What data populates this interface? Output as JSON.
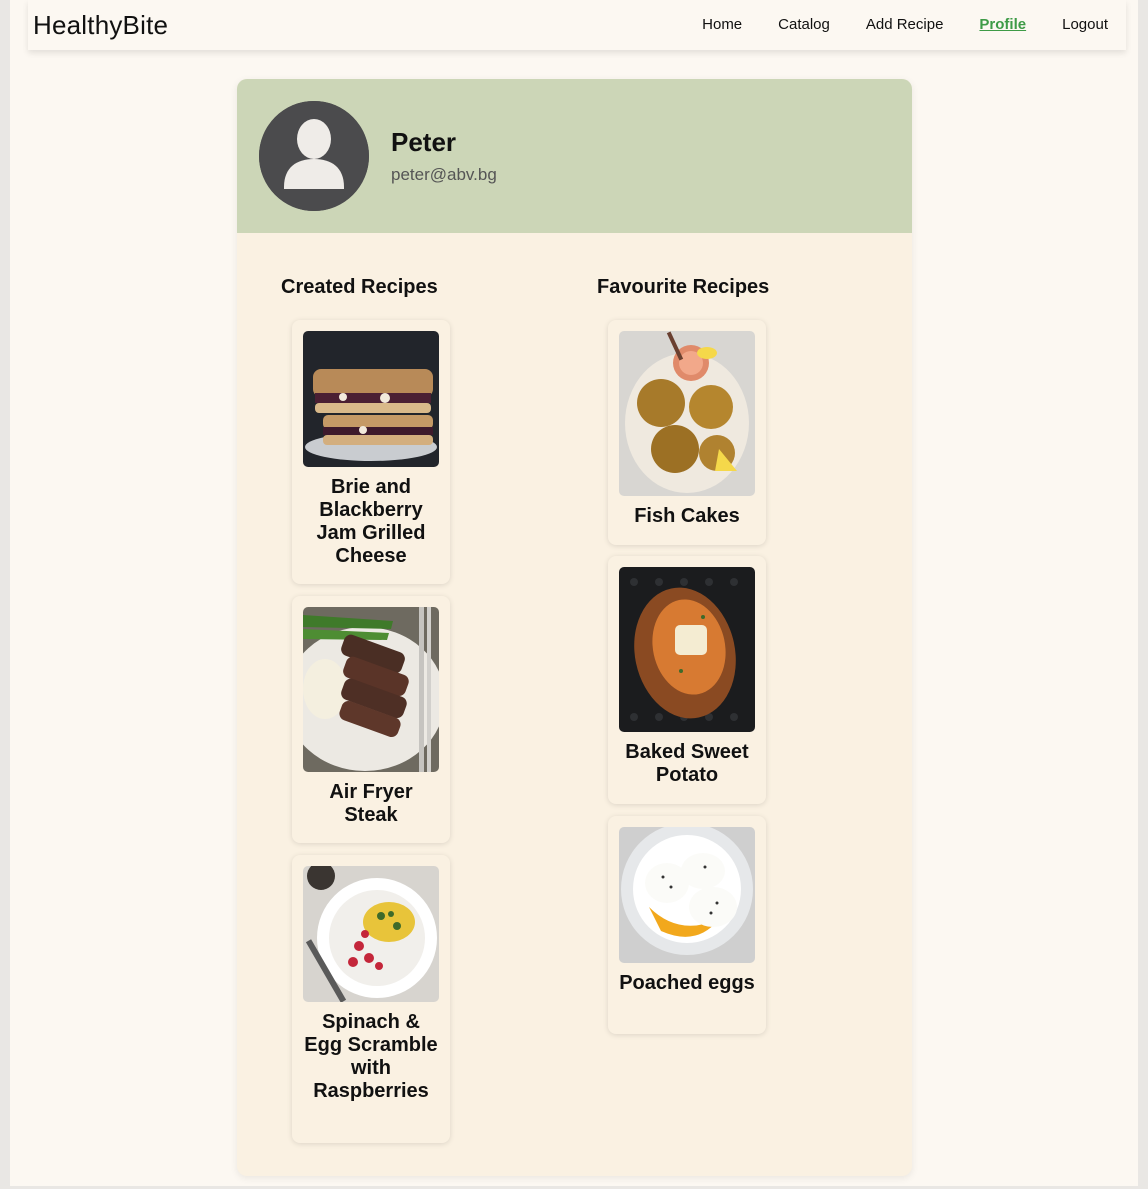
{
  "navbar": {
    "brand": "HealthyBite",
    "links": [
      {
        "label": "Home"
      },
      {
        "label": "Catalog"
      },
      {
        "label": "Add Recipe"
      },
      {
        "label": "Profile",
        "active": true
      },
      {
        "label": "Logout"
      }
    ],
    "active_color": "#3e9b47"
  },
  "profile": {
    "name": "Peter",
    "email": "peter@abv.bg",
    "avatar_icon": "user-silhouette-icon",
    "header_color": "#ccd6b7",
    "card_color": "#faf1e2"
  },
  "created": {
    "title": "Created Recipes",
    "recipes": [
      {
        "title": "Brie and Blackberry Jam Grilled Cheese",
        "image": "grilled-cheese-sandwich-photo"
      },
      {
        "title": "Air Fryer Steak",
        "image": "sliced-steak-photo"
      },
      {
        "title": "Spinach & Egg Scramble with Raspberries",
        "image": "egg-scramble-plate-photo"
      }
    ]
  },
  "favourites": {
    "title": "Favourite Recipes",
    "recipes": [
      {
        "title": "Fish Cakes",
        "image": "fish-cakes-photo"
      },
      {
        "title": "Baked Sweet Potato",
        "image": "baked-sweet-potato-photo"
      },
      {
        "title": "Poached eggs",
        "image": "poached-eggs-photo"
      }
    ]
  }
}
